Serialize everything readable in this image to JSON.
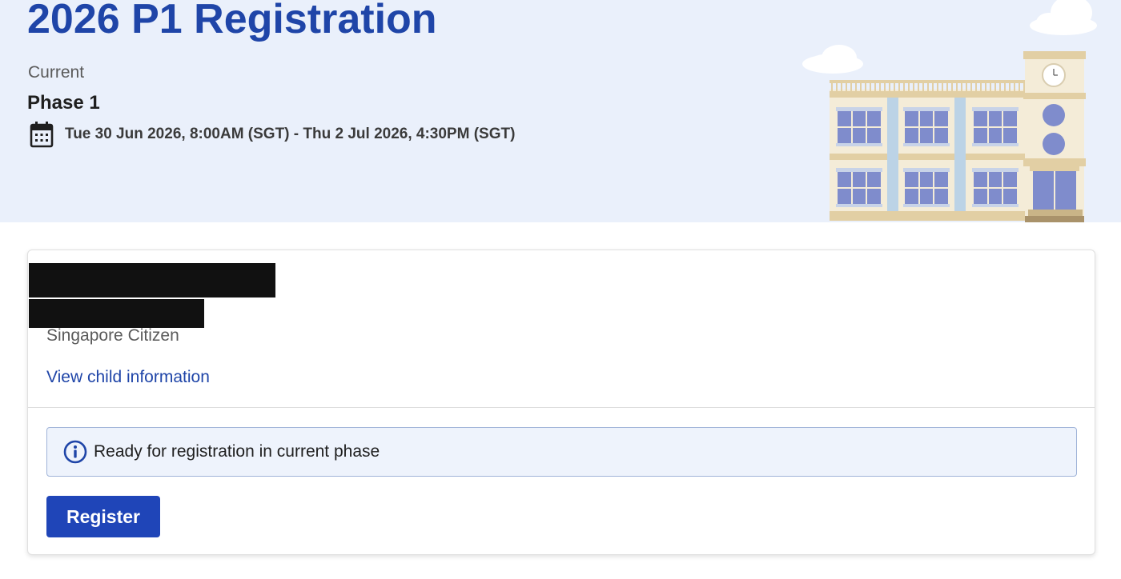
{
  "header": {
    "title": "2026 P1 Registration",
    "phase_status": "Current",
    "phase_name": "Phase 1",
    "date_range": "Tue 30 Jun 2026, 8:00AM (SGT) - Thu 2 Jul 2026, 4:30PM (SGT)",
    "illustration": "school-building"
  },
  "child_card": {
    "citizenship": "Singapore Citizen",
    "view_link": "View child information",
    "alert_text": "Ready for registration in current phase",
    "register_label": "Register"
  },
  "colors": {
    "brand_blue": "#1f45a8",
    "hero_background": "#eaf0fb",
    "button_blue": "#1f45b8",
    "alert_background": "#eef3fc"
  }
}
